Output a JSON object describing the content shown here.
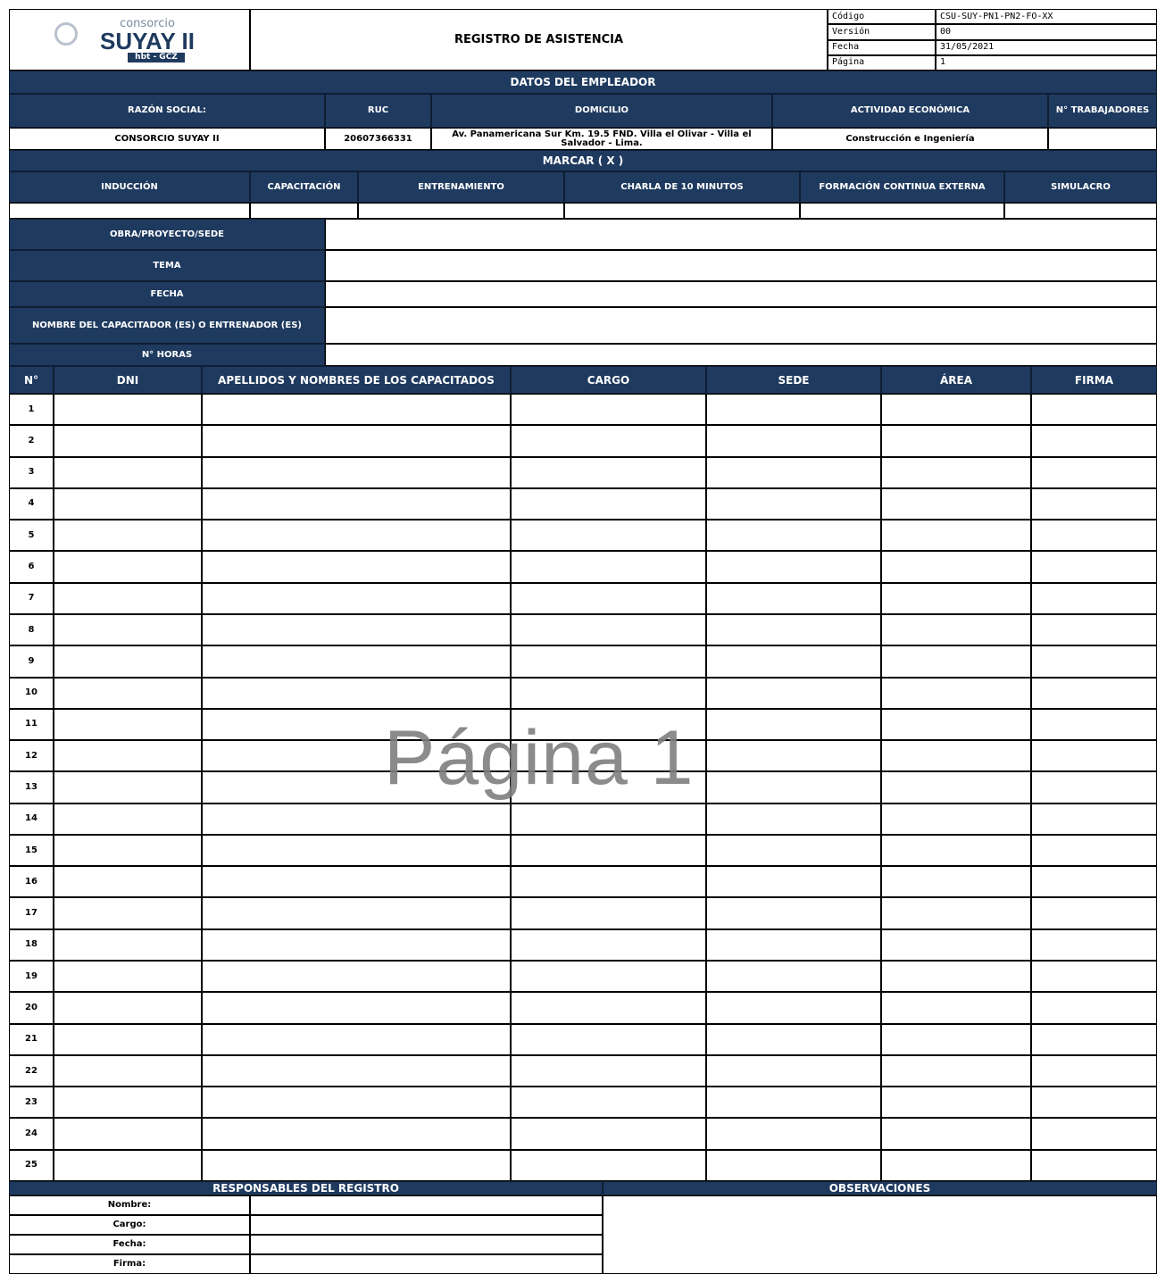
{
  "header": {
    "logo_top": "consorcio",
    "logo_main": "SUYAY II",
    "logo_sub": "hbt - GCZ",
    "title": "REGISTRO DE ASISTENCIA",
    "meta": [
      {
        "label": "Código",
        "value": "CSU-SUY-PN1-PN2-FO-XX"
      },
      {
        "label": "Versión",
        "value": "00"
      },
      {
        "label": "Fecha",
        "value": "31/05/2021"
      },
      {
        "label": "Página",
        "value": "1"
      }
    ]
  },
  "empleador": {
    "section_title": "DATOS DEL EMPLEADOR",
    "headers": [
      "RAZÓN SOCIAL:",
      "RUC",
      "DOMICILIO",
      "ACTIVIDAD ECONÓMICA",
      "N° TRABAJADORES"
    ],
    "values": [
      "CONSORCIO SUYAY II",
      "20607366331",
      "Av. Panamericana Sur Km. 19.5 FND. Villa el Olivar - Villa el Salvador - Lima.",
      "Construcción e Ingeniería",
      ""
    ]
  },
  "marcar": {
    "section_title": "MARCAR ( X )",
    "options": [
      "INDUCCIÓN",
      "CAPACITACIÓN",
      "ENTRENAMIENTO",
      "CHARLA DE 10 MINUTOS",
      "FORMACIÓN CONTINUA EXTERNA",
      "SIMULACRO"
    ]
  },
  "info_fields": [
    {
      "label": "OBRA/PROYECTO/SEDE",
      "value": ""
    },
    {
      "label": "TEMA",
      "value": ""
    },
    {
      "label": "FECHA",
      "value": ""
    },
    {
      "label": "NOMBRE DEL CAPACITADOR (ES) O ENTRENADOR (ES)",
      "value": ""
    },
    {
      "label": "N° HORAS",
      "value": ""
    }
  ],
  "attendance": {
    "columns": [
      "N°",
      "DNI",
      "APELLIDOS Y NOMBRES DE LOS CAPACITADOS",
      "CARGO",
      "SEDE",
      "ÁREA",
      "FIRMA"
    ],
    "row_numbers": [
      "1",
      "2",
      "3",
      "4",
      "5",
      "6",
      "7",
      "8",
      "9",
      "10",
      "11",
      "12",
      "13",
      "14",
      "15",
      "16",
      "17",
      "18",
      "19",
      "20",
      "21",
      "22",
      "23",
      "24",
      "25"
    ]
  },
  "footer": {
    "responsables_title": "RESPONSABLES DEL REGISTRO",
    "observaciones_title": "OBSERVACIONES",
    "fields": [
      "Nombre:",
      "Cargo:",
      "Fecha:",
      "Firma:"
    ]
  },
  "watermark": "Página 1",
  "colors": {
    "header_fill": "#1f3a5f",
    "header_text": "#ffffff"
  }
}
